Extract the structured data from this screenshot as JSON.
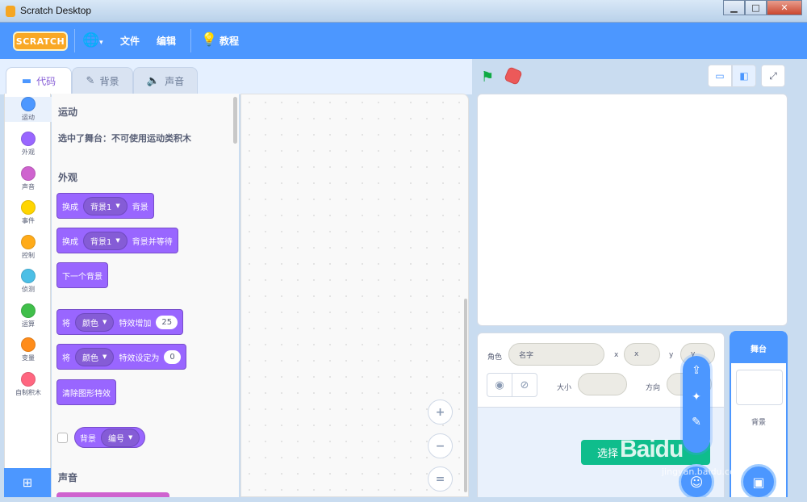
{
  "window": {
    "title": "Scratch Desktop",
    "minimize": "▁",
    "maximize": "□",
    "close": "✕"
  },
  "menu": {
    "logo": "SCRATCH",
    "file": "文件",
    "edit": "编辑",
    "tutorials": "教程"
  },
  "tabs": {
    "code": "代码",
    "backdrops": "背景",
    "sounds": "声音"
  },
  "categories": [
    {
      "label": "运动",
      "color": "#4c97ff"
    },
    {
      "label": "外观",
      "color": "#9966ff"
    },
    {
      "label": "声音",
      "color": "#cf63cf"
    },
    {
      "label": "事件",
      "color": "#ffd500"
    },
    {
      "label": "控制",
      "color": "#ffab19"
    },
    {
      "label": "侦测",
      "color": "#4cbfe6"
    },
    {
      "label": "运算",
      "color": "#40bf4a"
    },
    {
      "label": "变量",
      "color": "#ff8c1a"
    },
    {
      "label": "自制积木",
      "color": "#ff6680"
    }
  ],
  "palette": {
    "motion_head": "运动",
    "motion_note": "选中了舞台：不可使用运动类积木",
    "looks_head": "外观",
    "b1": {
      "verb": "换成",
      "dd": "背景1",
      "tail": "背景"
    },
    "b2": {
      "verb": "换成",
      "dd": "背景1",
      "tail": "背景并等待"
    },
    "b3": {
      "text": "下一个背景"
    },
    "b4": {
      "verb": "将",
      "dd": "颜色",
      "tail": "特效增加",
      "num": "25"
    },
    "b5": {
      "verb": "将",
      "dd": "颜色",
      "tail": "特效设定为",
      "num": "0"
    },
    "b6": {
      "text": "清除图形特效"
    },
    "r1": {
      "text": "背景",
      "dd": "编号"
    },
    "sound_head": "声音"
  },
  "zoom": {
    "in": "+",
    "out": "−",
    "reset": "="
  },
  "sprite": {
    "sprite_label": "角色",
    "name_placeholder": "名字",
    "x_label": "x",
    "x_placeholder": "x",
    "y_label": "y",
    "y_placeholder": "y",
    "size_label": "大小",
    "direction_label": "方向",
    "choose_label": "选择"
  },
  "stage_selector": {
    "head": "舞台",
    "backdrops_label": "背景"
  },
  "watermark": {
    "main": "Baidu",
    "sub": "jingyan.baidu.com"
  }
}
